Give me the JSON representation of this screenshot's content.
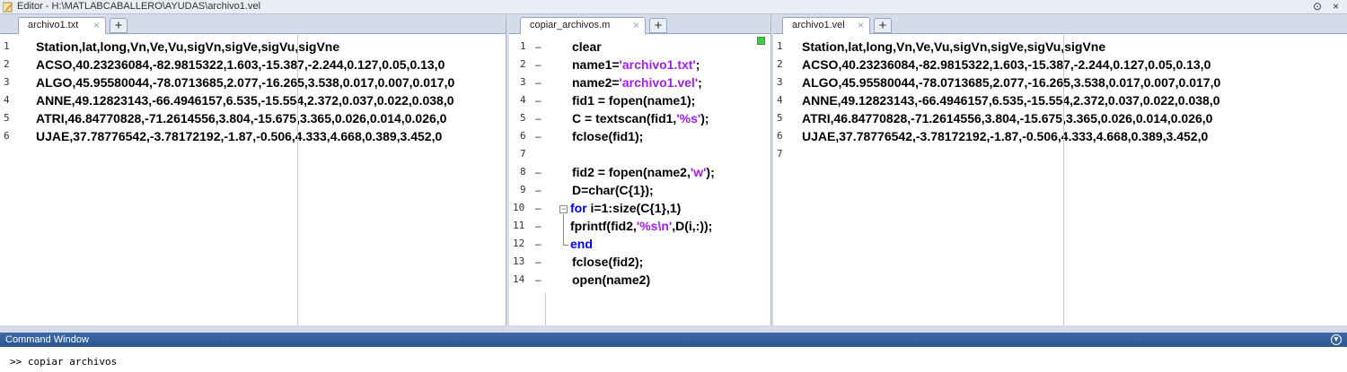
{
  "window": {
    "title": "Editor - H:\\MATLABCABALLERO\\AYUDAS\\archivo1.vel",
    "minimize_glyph": "⊙",
    "close_glyph": "×"
  },
  "left_pane": {
    "tab_label": "archivo1.txt",
    "lines": [
      "Station,lat,long,Vn,Ve,Vu,sigVn,sigVe,sigVu,sigVne",
      "ACSO,40.23236084,-82.9815322,1.603,-15.387,-2.244,0.127,0.05,0.13,0",
      "ALGO,45.95580044,-78.0713685,2.077,-16.265,3.538,0.017,0.007,0.017,0",
      "ANNE,49.12823143,-66.4946157,6.535,-15.554,2.372,0.037,0.022,0.038,0",
      "ATRI,46.84770828,-71.2614556,3.804,-15.675,3.365,0.026,0.014,0.026,0",
      "UJAE,37.78776542,-3.78172192,-1.87,-0.506,4.333,4.668,0.389,3.452,0"
    ],
    "line_numbers": [
      "1",
      "2",
      "3",
      "4",
      "5",
      "6"
    ]
  },
  "middle_pane": {
    "tab_label": "copiar_archivos.m",
    "line_numbers": [
      "1",
      "2",
      "3",
      "4",
      "5",
      "6",
      "7",
      "8",
      "9",
      "10",
      "11",
      "12",
      "13",
      "14"
    ],
    "lines": [
      [
        {
          "t": "clear",
          "c": ""
        }
      ],
      [
        {
          "t": "name1=",
          "c": ""
        },
        {
          "t": "'archivo1.txt'",
          "c": "str"
        },
        {
          "t": ";",
          "c": ""
        }
      ],
      [
        {
          "t": "name2=",
          "c": ""
        },
        {
          "t": "'archivo1.vel'",
          "c": "str"
        },
        {
          "t": ";",
          "c": ""
        }
      ],
      [
        {
          "t": "fid1 = fopen(name1);",
          "c": ""
        }
      ],
      [
        {
          "t": "C = textscan(fid1,",
          "c": ""
        },
        {
          "t": "'%s'",
          "c": "str"
        },
        {
          "t": ");",
          "c": ""
        }
      ],
      [
        {
          "t": "fclose(fid1);",
          "c": ""
        }
      ],
      [],
      [
        {
          "t": "fid2 = fopen(name2,",
          "c": ""
        },
        {
          "t": "'w'",
          "c": "str"
        },
        {
          "t": ");",
          "c": ""
        }
      ],
      [
        {
          "t": "D=char(C{1});",
          "c": ""
        }
      ],
      [
        {
          "t": "for",
          "c": "kw"
        },
        {
          "t": " i=1:size(C{1},1)",
          "c": ""
        }
      ],
      [
        {
          "t": " fprintf(fid2,",
          "c": ""
        },
        {
          "t": "'%s\\n'",
          "c": "str"
        },
        {
          "t": ",D(i,:));",
          "c": ""
        }
      ],
      [
        {
          "t": "end",
          "c": "kw"
        }
      ],
      [
        {
          "t": "fclose(fid2);",
          "c": ""
        }
      ],
      [
        {
          "t": "open(name2)",
          "c": ""
        }
      ]
    ],
    "dashed_lines": [
      1,
      2,
      3,
      4,
      5,
      6,
      8,
      9,
      10,
      11,
      12,
      13,
      14
    ]
  },
  "right_pane": {
    "tab_label": "archivo1.vel",
    "lines": [
      "Station,lat,long,Vn,Ve,Vu,sigVn,sigVe,sigVu,sigVne",
      "ACSO,40.23236084,-82.9815322,1.603,-15.387,-2.244,0.127,0.05,0.13,0",
      "ALGO,45.95580044,-78.0713685,2.077,-16.265,3.538,0.017,0.007,0.017,0",
      "ANNE,49.12823143,-66.4946157,6.535,-15.554,2.372,0.037,0.022,0.038,0",
      "ATRI,46.84770828,-71.2614556,3.804,-15.675,3.365,0.026,0.014,0.026,0",
      "UJAE,37.78776542,-3.78172192,-1.87,-0.506,4.333,4.668,0.389,3.452,0",
      ""
    ],
    "line_numbers": [
      "1",
      "2",
      "3",
      "4",
      "5",
      "6",
      "7"
    ]
  },
  "command_window": {
    "title": "Command Window",
    "command_line": ">> copiar archivos"
  },
  "icons": {
    "tab_close": "×",
    "tab_add": "+"
  },
  "colors": {
    "string": "#a020f0",
    "keyword": "#0000ff",
    "header": "#2c5791",
    "status_ok": "#46c846"
  }
}
